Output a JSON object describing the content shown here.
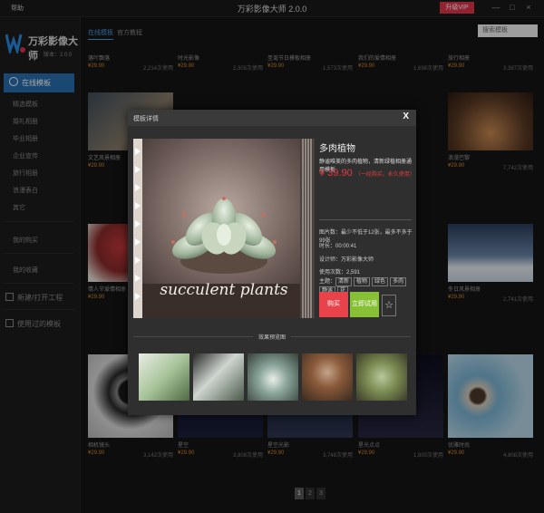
{
  "titlebar": {
    "help": "帮助",
    "title": "万彩影像大师 2.0.0",
    "upgrade": "升级VIP",
    "minimize": "—",
    "maximize": "□",
    "close": "×"
  },
  "sidebar": {
    "logo_name": "万彩影像",
    "logo_subtitle": "大师",
    "logo_version": "版本：2.0.0",
    "active": "在线模板",
    "sub_items": [
      "精选模板",
      "婚礼相册",
      "毕业相册",
      "企业宣传",
      "旅行相册",
      "浪漫表白",
      "其它"
    ],
    "my_items": [
      "我的购买",
      "我的收藏"
    ],
    "main_items": [
      "新建/打开工程",
      "使用过的模板"
    ]
  },
  "tabs": [
    "在线模板",
    "官方教程"
  ],
  "search_placeholder": "搜索模板",
  "cards_top": [
    {
      "name": "落叶飘落",
      "price": "¥29.90",
      "uses": "2,214次使用"
    },
    {
      "name": "时光影像",
      "price": "¥29.90",
      "uses": "2,305次使用"
    },
    {
      "name": "圣诞节日模板相册",
      "price": "¥29.90",
      "uses": "1,573次使用"
    },
    {
      "name": "我们的爱情相册",
      "price": "¥29.90",
      "uses": "1,698次使用"
    },
    {
      "name": "旅行相册",
      "price": "¥29.90",
      "uses": "3,387次使用"
    }
  ],
  "cards_mid1": [
    {
      "name": "文艺风景相册",
      "price": "¥29.90",
      "uses": ""
    },
    {
      "name": "浪漫巴黎",
      "price": "¥29.90",
      "uses": "7,742次使用"
    }
  ],
  "cards_mid2": [
    {
      "name": "情人节爱情相册",
      "price": "¥29.90",
      "uses": ""
    },
    {
      "name": "冬日风景相册",
      "price": "¥29.90",
      "uses": "2,741次使用"
    }
  ],
  "cards_bottom": [
    {
      "name": "相机镜头",
      "price": "¥29.90",
      "uses": "3,142次使用"
    },
    {
      "name": "星空",
      "price": "¥29.90",
      "uses": "3,808次使用"
    },
    {
      "name": "星空光影",
      "price": "¥29.90",
      "uses": "3,748次使用"
    },
    {
      "name": "星光点点",
      "price": "¥29.90",
      "uses": "1,800次使用"
    },
    {
      "name": "优雅时尚",
      "price": "¥29.90",
      "uses": "4,808次使用"
    }
  ],
  "pager": [
    "1",
    "2",
    "3"
  ],
  "modal": {
    "title": "模板详情",
    "close": "X",
    "preview_caption": "succulent plants",
    "product_title": "多肉植物",
    "description": "静谧唯美的多肉植物，清新绿植相册通用模板",
    "price": "¥ 39.90",
    "price_note": "（一经购买，永久使用）",
    "info": [
      "图片数：最少不低于12张，最多不多于99张",
      "时长：00:00:41",
      "设计师：万彩影像大师",
      "使用次数：2,591"
    ],
    "tags_label": "主题：",
    "tags": [
      "清新",
      "植物",
      "绿色",
      "多肉",
      "静谧",
      "花"
    ],
    "buy": "购买",
    "try": "立即试用",
    "fav": "☆",
    "effects_title": "效果预览图"
  }
}
